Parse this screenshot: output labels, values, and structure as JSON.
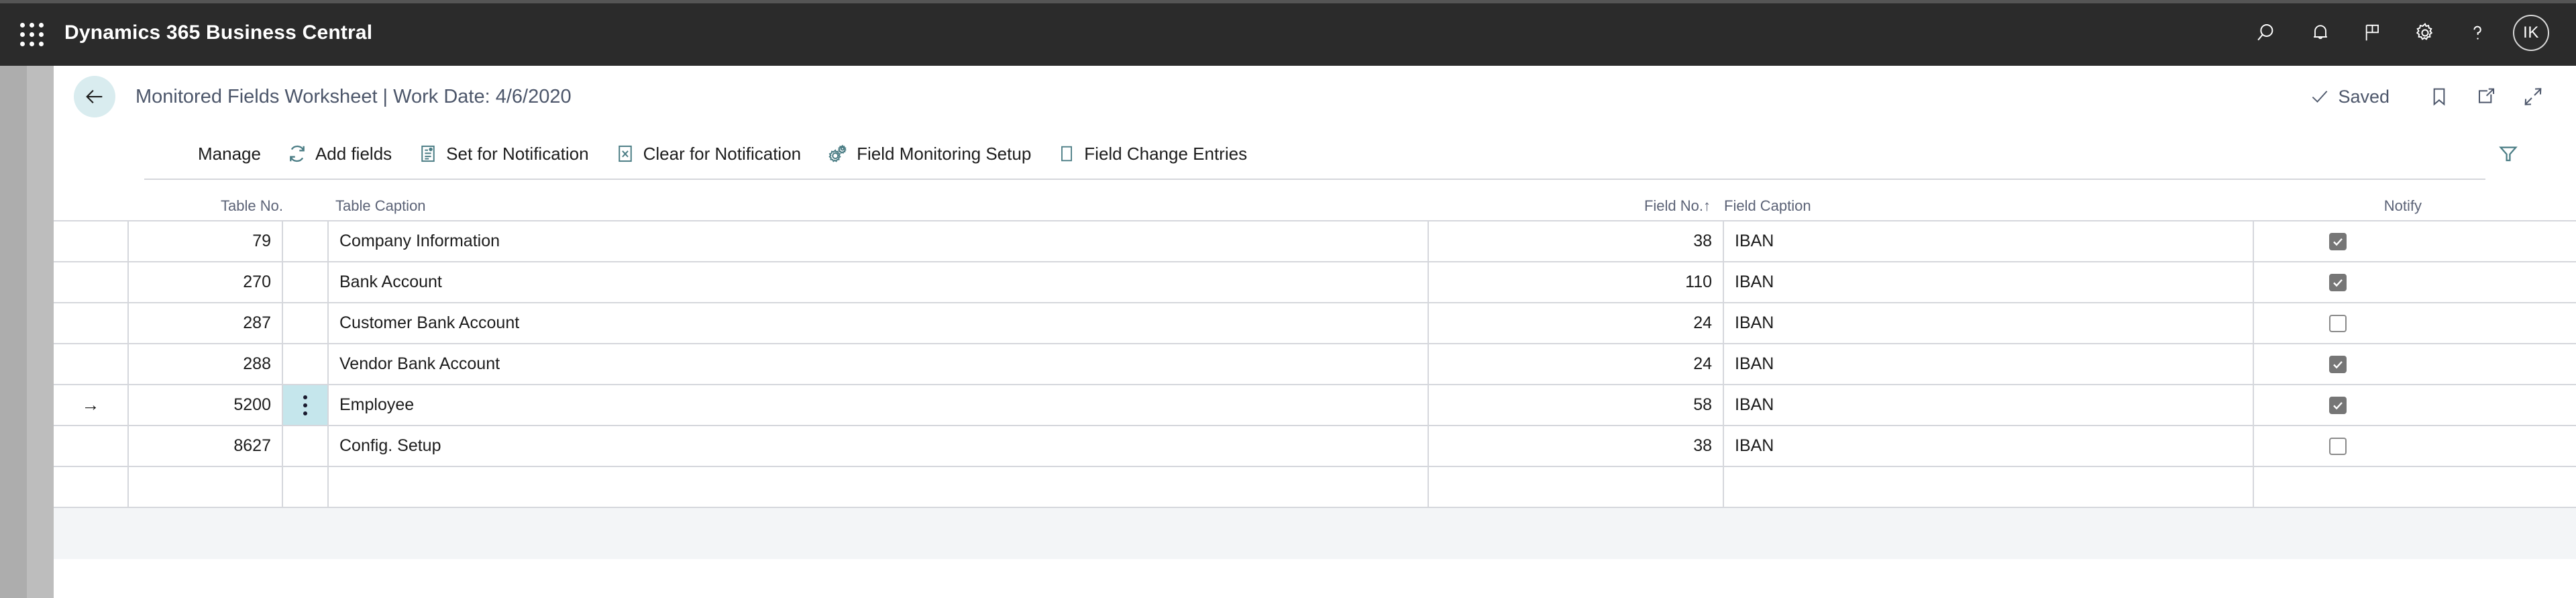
{
  "appbar": {
    "title": "Dynamics 365 Business Central",
    "waffle_icon": "waffle-grid-icon",
    "icons": [
      {
        "name": "search-icon",
        "label": "Search"
      },
      {
        "name": "notifications-bell-icon",
        "label": "Notifications"
      },
      {
        "name": "flag-icon",
        "label": "Feedback"
      },
      {
        "name": "gear-icon",
        "label": "Settings"
      },
      {
        "name": "help-question-icon",
        "label": "Help"
      }
    ],
    "avatar_initials": "IK"
  },
  "titlebar": {
    "back_icon": "back-arrow-icon",
    "title": "Monitored Fields Worksheet | Work Date: 4/6/2020",
    "saved_label": "Saved",
    "saved_icon": "checkmark-icon",
    "bookmark_icon": "bookmark-icon",
    "open_new_window_icon": "open-in-new-window-icon",
    "collapse_icon": "collapse-icon"
  },
  "commandbar": {
    "items": [
      {
        "label": "Manage",
        "icon": ""
      },
      {
        "label": "Add fields",
        "icon": "refresh-icon"
      },
      {
        "label": "Set for Notification",
        "icon": "set-notification-icon"
      },
      {
        "label": "Clear for Notification",
        "icon": "clear-notification-icon"
      },
      {
        "label": "Field Monitoring Setup",
        "icon": "gears-setup-icon"
      },
      {
        "label": "Field Change Entries",
        "icon": "document-entries-icon"
      }
    ],
    "filter_icon": "filter-funnel-icon"
  },
  "grid": {
    "columns": [
      {
        "key": "indicator",
        "label": ""
      },
      {
        "key": "table_no",
        "label": "Table No."
      },
      {
        "key": "menu",
        "label": ""
      },
      {
        "key": "table_caption",
        "label": "Table Caption"
      },
      {
        "key": "field_no",
        "label": "Field No.",
        "sort": "ascending",
        "sort_glyph": "↑"
      },
      {
        "key": "field_caption",
        "label": "Field Caption"
      },
      {
        "key": "notify",
        "label": "Notify"
      }
    ],
    "rows": [
      {
        "indicator": "",
        "table_no": "79",
        "table_caption": "Company Information",
        "field_no": "38",
        "field_caption": "IBAN",
        "notify": true,
        "selected": false
      },
      {
        "indicator": "",
        "table_no": "270",
        "table_caption": "Bank Account",
        "field_no": "110",
        "field_caption": "IBAN",
        "notify": true,
        "selected": false
      },
      {
        "indicator": "",
        "table_no": "287",
        "table_caption": "Customer Bank Account",
        "field_no": "24",
        "field_caption": "IBAN",
        "notify": false,
        "selected": false
      },
      {
        "indicator": "",
        "table_no": "288",
        "table_caption": "Vendor Bank Account",
        "field_no": "24",
        "field_caption": "IBAN",
        "notify": true,
        "selected": false
      },
      {
        "indicator": "→",
        "table_no": "5200",
        "table_caption": "Employee",
        "field_no": "58",
        "field_caption": "IBAN",
        "notify": true,
        "selected": true
      },
      {
        "indicator": "",
        "table_no": "8627",
        "table_caption": "Config. Setup",
        "field_no": "38",
        "field_caption": "IBAN",
        "notify": false,
        "selected": false
      },
      {
        "indicator": "",
        "table_no": "",
        "table_caption": "",
        "field_no": "",
        "field_caption": "",
        "notify": null,
        "selected": false
      }
    ]
  },
  "colors": {
    "appbar_bg": "#2b2b2b",
    "accent_teal": "#4a7c84",
    "selection_cyan": "#c5e6ec",
    "back_button_bg": "#d9ecef",
    "grid_line": "#d5d7dc",
    "header_text": "#5b6276",
    "footer_bg": "#f3f5f7"
  }
}
